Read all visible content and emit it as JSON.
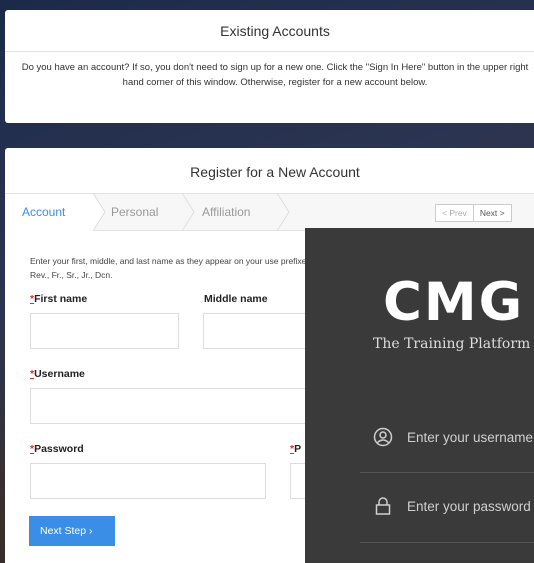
{
  "existing": {
    "title": "Existing Accounts",
    "text": "Do you have an account? If so, you don't need to sign up for a new one. Click the \"Sign In Here\" button in the upper right hand corner of this window. Otherwise, register for a new account below."
  },
  "register": {
    "title": "Register for a New Account",
    "steps": [
      "Account",
      "Personal",
      "Affiliation"
    ],
    "pager": {
      "prev": "< Prev",
      "next": "Next >"
    },
    "intro": "Enter your first, middle, and last name as they appear on your use prefixes, i.e., Rev., Fr., Sr., Jr., Dcn.",
    "required_mark": "*",
    "fields": {
      "first_name": "First name",
      "middle_name": "Middle name",
      "username": "Username",
      "password": "Password",
      "confirm_partial": "P"
    },
    "next_step": "Next Step ›"
  },
  "login": {
    "logo": "CMG",
    "tagline": "The Training Platform",
    "username_placeholder": "Enter your username",
    "password_placeholder": "Enter your password"
  }
}
